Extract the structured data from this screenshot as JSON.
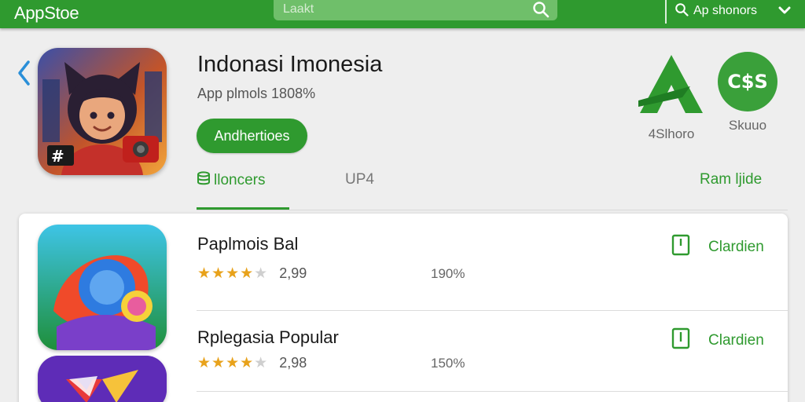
{
  "topbar": {
    "brand": "AppStoe",
    "search_placeholder": "Laakt",
    "search_label": "Ap shonors"
  },
  "app": {
    "title": "Indonasi Imonesia",
    "subtitle": "App plmols 1808%",
    "primary_button": "Andhertioes",
    "stats": [
      {
        "label": "4Slhoro",
        "badge": ""
      },
      {
        "label": "Skuuo",
        "badge": "C$S"
      }
    ]
  },
  "tabs": [
    {
      "label": "lloncers",
      "active": true
    },
    {
      "label": "UP4",
      "active": false
    },
    {
      "label": "Ram ljide",
      "active": false
    }
  ],
  "list": [
    {
      "title": "Paplmois Bal",
      "stars": 4,
      "rating": "2,99",
      "percent": "190%",
      "action": "Clardien"
    },
    {
      "title": "Rplegasia Popular",
      "stars": 4,
      "rating": "2,98",
      "percent": "150%",
      "action": "Clardien"
    }
  ],
  "colors": {
    "accent": "#2f9a2f",
    "star": "#e8a21b"
  }
}
